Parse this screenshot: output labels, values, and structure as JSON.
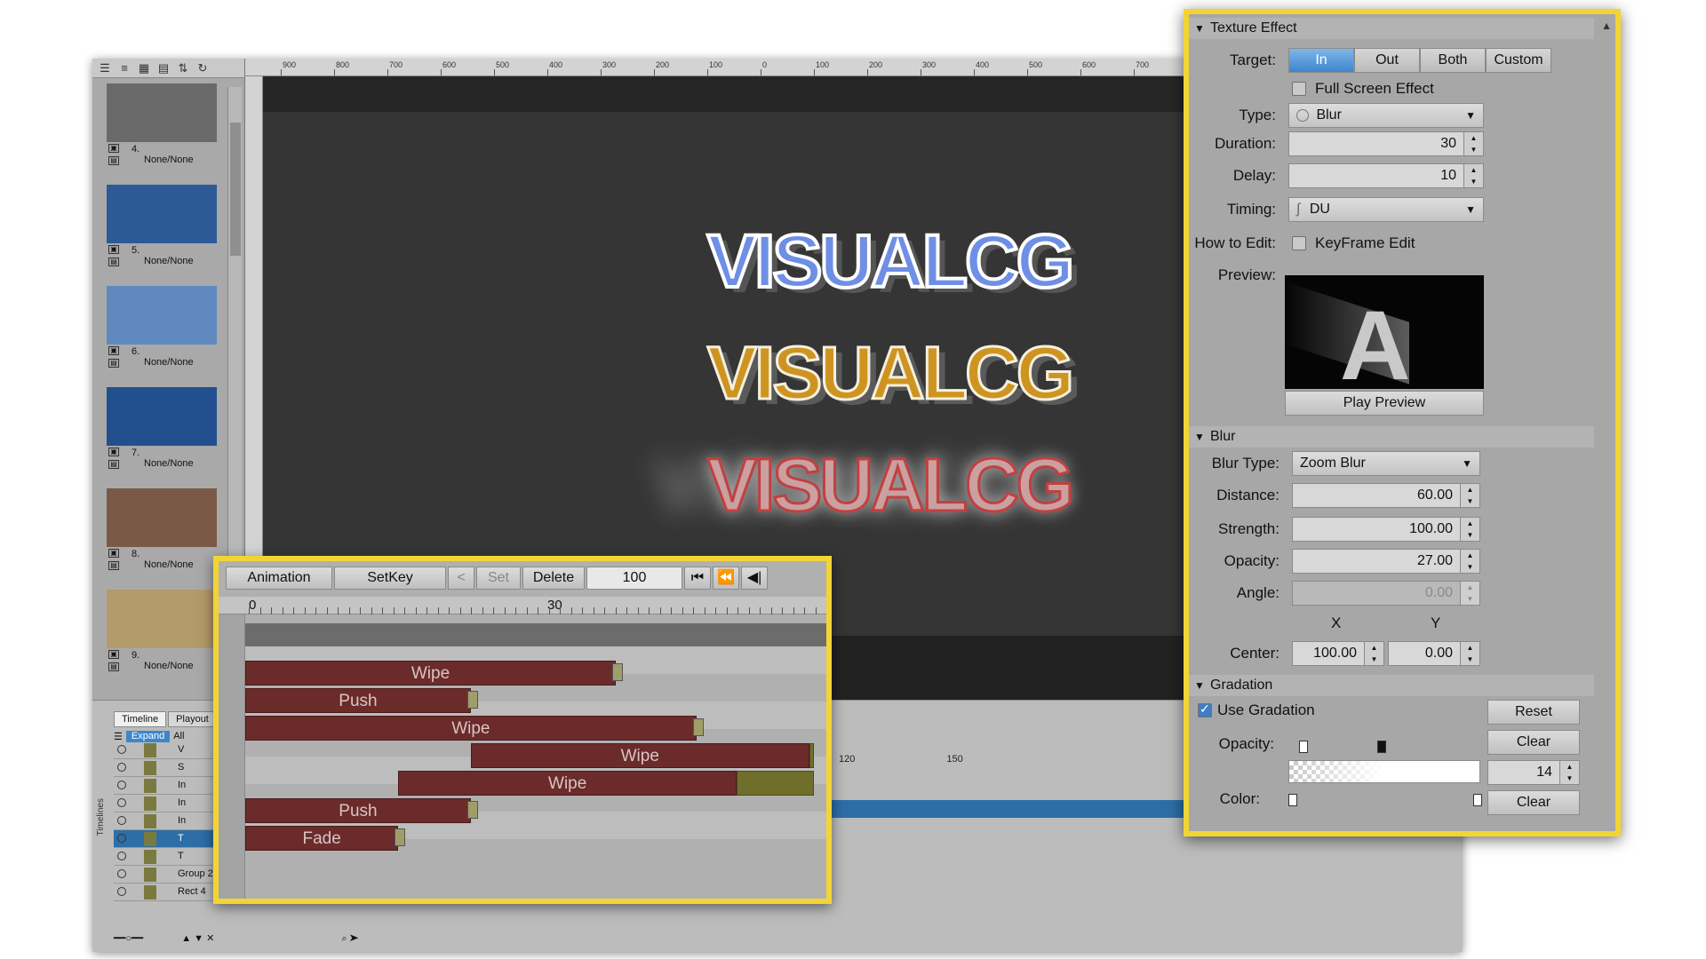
{
  "colors": {
    "highlight_border": "#f2d437",
    "accent_blue": "#3e86cc",
    "track_red": "#6b2b2b",
    "track_olive": "#6f6f2b",
    "selection": "#2d6ea7"
  },
  "left_toolbar": {
    "icons": [
      "list-icon",
      "menu-icon",
      "grid-icon",
      "layout-icon",
      "sort-icon",
      "refresh-icon"
    ]
  },
  "thumbnails": [
    {
      "index": "4.",
      "label": "None/None",
      "color": "#6a6a6a"
    },
    {
      "index": "5.",
      "label": "None/None",
      "color": "#2b5a96"
    },
    {
      "index": "6.",
      "label": "None/None",
      "color": "#5f89bf"
    },
    {
      "index": "7.",
      "label": "None/None",
      "color": "#22508f"
    },
    {
      "index": "8.",
      "label": "None/None",
      "color": "#7a5a46"
    },
    {
      "index": "9.",
      "label": "None/None",
      "color": "#b39a6a"
    },
    {
      "index": "",
      "label": "",
      "color": "#3a2a2a"
    }
  ],
  "canvas": {
    "ruler_labels": [
      "900",
      "800",
      "700",
      "600",
      "500",
      "400",
      "300",
      "200",
      "100",
      "0",
      "100",
      "200",
      "300",
      "400",
      "500",
      "600",
      "700"
    ],
    "logos": [
      "VISUALCG",
      "VISUALCG",
      "VISUALCG"
    ]
  },
  "timeline": {
    "tabs": [
      "Timeline",
      "Playout"
    ],
    "expand_label": "Expand",
    "all_label": "All",
    "side_label": "Timelines",
    "rows": [
      "V",
      "S",
      "In",
      "In",
      "In",
      "T",
      "T",
      "Group 2",
      "Rect 4"
    ],
    "ruler": [
      "120",
      "150"
    ]
  },
  "anim_panel": {
    "toolbar": {
      "animation": "Animation",
      "setkey": "SetKey",
      "prev": "<",
      "set": "Set",
      "delete": "Delete",
      "frame_value": "100",
      "first_icon": "⏮",
      "rewind_icon": "⏪",
      "step_back_icon": "◀|"
    },
    "ruler": [
      "0",
      "30"
    ],
    "bars": [
      {
        "label": "Wipe",
        "start": 0,
        "end": 46,
        "ext_end": null
      },
      {
        "label": "Push",
        "start": 0,
        "end": 28,
        "ext_end": null
      },
      {
        "label": "Wipe",
        "start": 0,
        "end": 56,
        "ext_end": null
      },
      {
        "label": "Wipe",
        "start": 28,
        "end": 70,
        "ext_end": 120
      },
      {
        "label": "Wipe",
        "start": 19,
        "end": 61,
        "ext_end": 120
      },
      {
        "label": "Push",
        "start": 0,
        "end": 28,
        "ext_end": null
      },
      {
        "label": "Fade",
        "start": 0,
        "end": 19,
        "ext_end": null
      }
    ]
  },
  "props": {
    "texture_effect": {
      "header": "Texture Effect",
      "target_label": "Target:",
      "targets": [
        "In",
        "Out",
        "Both",
        "Custom"
      ],
      "active_target": "In",
      "full_screen_label": "Full Screen Effect",
      "type_label": "Type:",
      "type_value": "Blur",
      "duration_label": "Duration:",
      "duration_value": "30",
      "delay_label": "Delay:",
      "delay_value": "10",
      "timing_label": "Timing:",
      "timing_value": "DU",
      "how_to_edit_label": "How to Edit:",
      "keyframe_label": "KeyFrame Edit",
      "preview_label": "Preview:",
      "preview_letter": "A",
      "play_preview": "Play Preview"
    },
    "blur": {
      "header": "Blur",
      "blur_type_label": "Blur Type:",
      "blur_type_value": "Zoom Blur",
      "distance_label": "Distance:",
      "distance_value": "60.00",
      "strength_label": "Strength:",
      "strength_value": "100.00",
      "opacity_label": "Opacity:",
      "opacity_value": "27.00",
      "angle_label": "Angle:",
      "angle_value": "0.00",
      "x_label": "X",
      "y_label": "Y",
      "center_label": "Center:",
      "center_x": "100.00",
      "center_y": "0.00"
    },
    "gradation": {
      "header": "Gradation",
      "use_label": "Use Gradation",
      "reset": "Reset",
      "opacity_label": "Opacity:",
      "clear1": "Clear",
      "value": "14",
      "color_label": "Color:",
      "clear2": "Clear"
    }
  }
}
